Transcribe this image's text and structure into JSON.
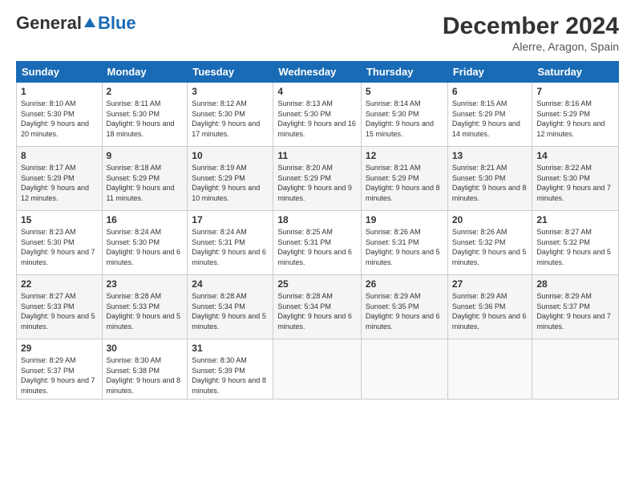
{
  "header": {
    "logo_general": "General",
    "logo_blue": "Blue",
    "month_title": "December 2024",
    "location": "Alerre, Aragon, Spain"
  },
  "weekdays": [
    "Sunday",
    "Monday",
    "Tuesday",
    "Wednesday",
    "Thursday",
    "Friday",
    "Saturday"
  ],
  "weeks": [
    [
      {
        "day": "1",
        "sunrise": "8:10 AM",
        "sunset": "5:30 PM",
        "daylight": "9 hours and 20 minutes."
      },
      {
        "day": "2",
        "sunrise": "8:11 AM",
        "sunset": "5:30 PM",
        "daylight": "9 hours and 18 minutes."
      },
      {
        "day": "3",
        "sunrise": "8:12 AM",
        "sunset": "5:30 PM",
        "daylight": "9 hours and 17 minutes."
      },
      {
        "day": "4",
        "sunrise": "8:13 AM",
        "sunset": "5:30 PM",
        "daylight": "9 hours and 16 minutes."
      },
      {
        "day": "5",
        "sunrise": "8:14 AM",
        "sunset": "5:30 PM",
        "daylight": "9 hours and 15 minutes."
      },
      {
        "day": "6",
        "sunrise": "8:15 AM",
        "sunset": "5:29 PM",
        "daylight": "9 hours and 14 minutes."
      },
      {
        "day": "7",
        "sunrise": "8:16 AM",
        "sunset": "5:29 PM",
        "daylight": "9 hours and 12 minutes."
      }
    ],
    [
      {
        "day": "8",
        "sunrise": "8:17 AM",
        "sunset": "5:29 PM",
        "daylight": "9 hours and 12 minutes."
      },
      {
        "day": "9",
        "sunrise": "8:18 AM",
        "sunset": "5:29 PM",
        "daylight": "9 hours and 11 minutes."
      },
      {
        "day": "10",
        "sunrise": "8:19 AM",
        "sunset": "5:29 PM",
        "daylight": "9 hours and 10 minutes."
      },
      {
        "day": "11",
        "sunrise": "8:20 AM",
        "sunset": "5:29 PM",
        "daylight": "9 hours and 9 minutes."
      },
      {
        "day": "12",
        "sunrise": "8:21 AM",
        "sunset": "5:29 PM",
        "daylight": "9 hours and 8 minutes."
      },
      {
        "day": "13",
        "sunrise": "8:21 AM",
        "sunset": "5:30 PM",
        "daylight": "9 hours and 8 minutes."
      },
      {
        "day": "14",
        "sunrise": "8:22 AM",
        "sunset": "5:30 PM",
        "daylight": "9 hours and 7 minutes."
      }
    ],
    [
      {
        "day": "15",
        "sunrise": "8:23 AM",
        "sunset": "5:30 PM",
        "daylight": "9 hours and 7 minutes."
      },
      {
        "day": "16",
        "sunrise": "8:24 AM",
        "sunset": "5:30 PM",
        "daylight": "9 hours and 6 minutes."
      },
      {
        "day": "17",
        "sunrise": "8:24 AM",
        "sunset": "5:31 PM",
        "daylight": "9 hours and 6 minutes."
      },
      {
        "day": "18",
        "sunrise": "8:25 AM",
        "sunset": "5:31 PM",
        "daylight": "9 hours and 6 minutes."
      },
      {
        "day": "19",
        "sunrise": "8:26 AM",
        "sunset": "5:31 PM",
        "daylight": "9 hours and 5 minutes."
      },
      {
        "day": "20",
        "sunrise": "8:26 AM",
        "sunset": "5:32 PM",
        "daylight": "9 hours and 5 minutes."
      },
      {
        "day": "21",
        "sunrise": "8:27 AM",
        "sunset": "5:32 PM",
        "daylight": "9 hours and 5 minutes."
      }
    ],
    [
      {
        "day": "22",
        "sunrise": "8:27 AM",
        "sunset": "5:33 PM",
        "daylight": "9 hours and 5 minutes."
      },
      {
        "day": "23",
        "sunrise": "8:28 AM",
        "sunset": "5:33 PM",
        "daylight": "9 hours and 5 minutes."
      },
      {
        "day": "24",
        "sunrise": "8:28 AM",
        "sunset": "5:34 PM",
        "daylight": "9 hours and 5 minutes."
      },
      {
        "day": "25",
        "sunrise": "8:28 AM",
        "sunset": "5:34 PM",
        "daylight": "9 hours and 6 minutes."
      },
      {
        "day": "26",
        "sunrise": "8:29 AM",
        "sunset": "5:35 PM",
        "daylight": "9 hours and 6 minutes."
      },
      {
        "day": "27",
        "sunrise": "8:29 AM",
        "sunset": "5:36 PM",
        "daylight": "9 hours and 6 minutes."
      },
      {
        "day": "28",
        "sunrise": "8:29 AM",
        "sunset": "5:37 PM",
        "daylight": "9 hours and 7 minutes."
      }
    ],
    [
      {
        "day": "29",
        "sunrise": "8:29 AM",
        "sunset": "5:37 PM",
        "daylight": "9 hours and 7 minutes."
      },
      {
        "day": "30",
        "sunrise": "8:30 AM",
        "sunset": "5:38 PM",
        "daylight": "9 hours and 8 minutes."
      },
      {
        "day": "31",
        "sunrise": "8:30 AM",
        "sunset": "5:39 PM",
        "daylight": "9 hours and 8 minutes."
      },
      null,
      null,
      null,
      null
    ]
  ],
  "labels": {
    "sunrise": "Sunrise:",
    "sunset": "Sunset:",
    "daylight": "Daylight:"
  }
}
